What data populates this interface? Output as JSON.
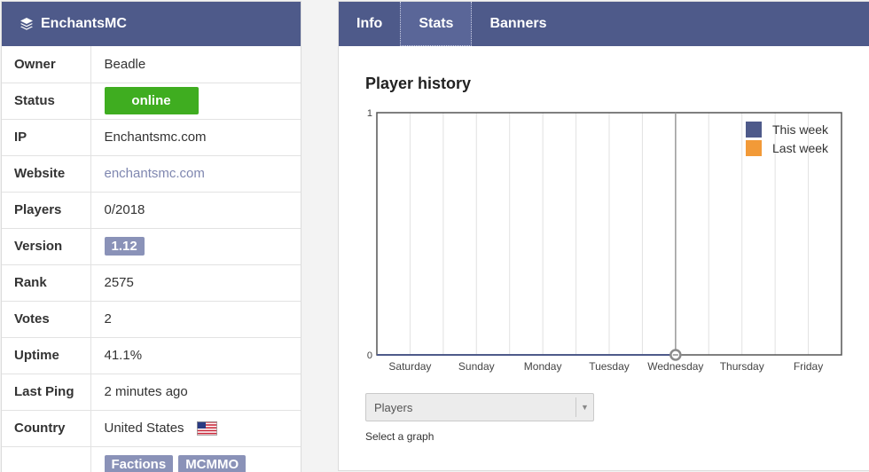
{
  "server": {
    "name": "EnchantsMC",
    "header_icon": "layers-icon"
  },
  "info_rows": [
    {
      "key": "owner",
      "label": "Owner",
      "value": "Beadle"
    },
    {
      "key": "status",
      "label": "Status",
      "value": "online"
    },
    {
      "key": "ip",
      "label": "IP",
      "value": "Enchantsmc.com"
    },
    {
      "key": "website",
      "label": "Website",
      "value": "enchantsmc.com"
    },
    {
      "key": "players",
      "label": "Players",
      "value": "0/2018"
    },
    {
      "key": "version",
      "label": "Version",
      "value": "1.12"
    },
    {
      "key": "rank",
      "label": "Rank",
      "value": "2575"
    },
    {
      "key": "votes",
      "label": "Votes",
      "value": "2"
    },
    {
      "key": "uptime",
      "label": "Uptime",
      "value": "41.1%"
    },
    {
      "key": "last_ping",
      "label": "Last Ping",
      "value": "2 minutes ago"
    },
    {
      "key": "country",
      "label": "Country",
      "value": "United States",
      "icon": "us-flag-icon"
    },
    {
      "key": "tags",
      "label": "",
      "tags": [
        "Factions",
        "MCMMO"
      ]
    }
  ],
  "tabs": [
    {
      "label": "Info",
      "active": false
    },
    {
      "label": "Stats",
      "active": true
    },
    {
      "label": "Banners",
      "active": false
    }
  ],
  "chart_section": {
    "title": "Player history",
    "select_value": "Players",
    "select_help": "Select a graph"
  },
  "colors": {
    "header": "#4e5a8a",
    "online": "#3fad20",
    "tag": "#8a92b8",
    "this_week": "#4e5a8a",
    "last_week": "#f29a38"
  },
  "chart_data": {
    "type": "line",
    "title": "Player history",
    "categories": [
      "Saturday",
      "Sunday",
      "Monday",
      "Tuesday",
      "Wednesday",
      "Thursday",
      "Friday"
    ],
    "ylim": [
      0,
      1
    ],
    "yticks": [
      "1",
      "0"
    ],
    "series": [
      {
        "name": "This week",
        "color": "#4e5a8a",
        "values": [
          0,
          0,
          0,
          0,
          0
        ]
      },
      {
        "name": "Last week",
        "color": "#f29a38",
        "values": []
      }
    ],
    "legend": "top-right",
    "hover_marker_category": "Wednesday",
    "grid": true
  }
}
